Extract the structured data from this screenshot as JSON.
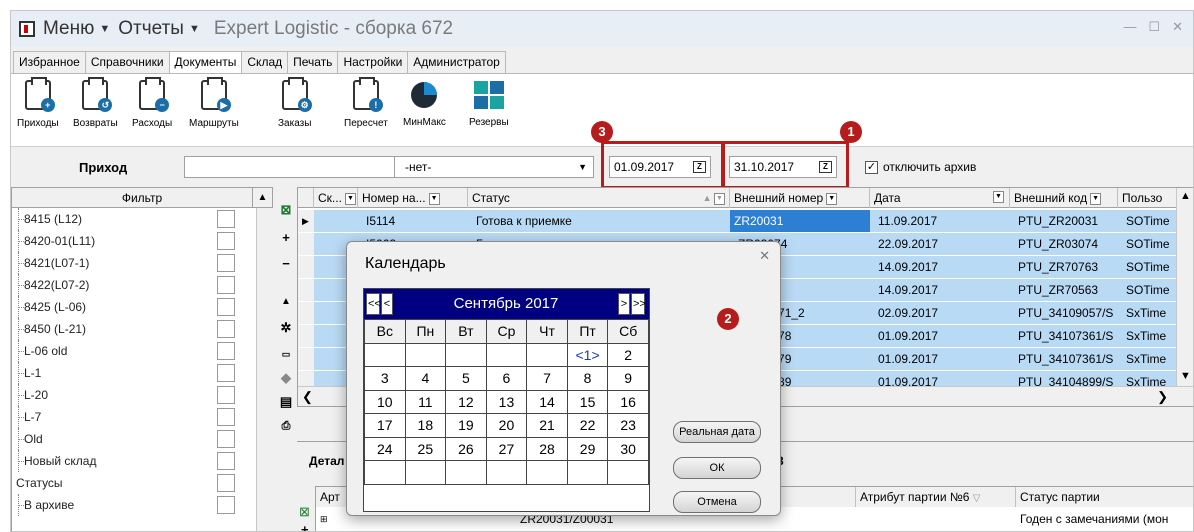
{
  "app": {
    "menu_label": "Меню",
    "reports_label": "Отчеты",
    "title": "Expert Logistic - сборка 672"
  },
  "tabs": [
    "Избранное",
    "Справочники",
    "Документы",
    "Склад",
    "Печать",
    "Настройки",
    "Администратор"
  ],
  "ribbon": {
    "buttons": [
      {
        "label": "Приходы",
        "icon": "incoming-icon"
      },
      {
        "label": "Возвраты",
        "icon": "returns-icon"
      },
      {
        "label": "Расходы",
        "icon": "outgoing-icon"
      },
      {
        "label": "Маршруты",
        "icon": "routes-icon"
      },
      {
        "label": "Заказы",
        "icon": "orders-icon"
      },
      {
        "label": "Пересчет",
        "icon": "recount-icon"
      },
      {
        "label": "МинМакс",
        "icon": "pie-chart-icon"
      },
      {
        "label": "Резервы",
        "icon": "grid-icon"
      }
    ]
  },
  "filterbar": {
    "doc_type": "Приход",
    "status_select": "-нет-",
    "date_from": "01.09.2017",
    "date_to": "31.10.2017",
    "archive_checkbox": "отключить архив",
    "archive_checked": true
  },
  "markers": [
    "1",
    "2",
    "3"
  ],
  "left_panel": {
    "header": "Фильтр",
    "items": [
      "8415 (L12)",
      "8420-01(L11)",
      "8421(L07-1)",
      "8422(L07-2)",
      "8425 (L-06)",
      "8450 (L-21)",
      "L-06 old",
      "L-1",
      "L-20",
      "L-7",
      "Old",
      "Новый склад"
    ],
    "section": "Статусы",
    "section_item": "В архиве"
  },
  "grid": {
    "columns": [
      "Ск...",
      "Номер на...",
      "Статус",
      "Внешний номер",
      "Дата",
      "Внешний код",
      "Пользо"
    ],
    "rows": [
      {
        "num": "I5114",
        "status": "Готова к приемке",
        "ext": "ZR20031",
        "date": "11.09.2017",
        "code": "PTU_ZR20031",
        "user": "SOTime"
      },
      {
        "num": "I5062",
        "status": "Готова к приемке",
        "ext": "ZR03074",
        "date": "22.09.2017",
        "code": "PTU_ZR03074",
        "user": "SOTime"
      },
      {
        "num": "",
        "status": "",
        "ext": "",
        "date": "14.09.2017",
        "code": "PTU_ZR70763",
        "user": "SOTime"
      },
      {
        "num": "",
        "status": "",
        "ext": "",
        "date": "14.09.2017",
        "code": "PTU_ZR70563",
        "user": "SOTime"
      },
      {
        "num": "",
        "status": "",
        "ext": "7/SH0471_2",
        "date": "02.09.2017",
        "code": "PTU_34109057/S",
        "user": "SxTime"
      },
      {
        "num": "",
        "status": "",
        "ext": "1/SH0578",
        "date": "01.09.2017",
        "code": "PTU_34107361/S",
        "user": "SxTime"
      },
      {
        "num": "",
        "status": "",
        "ext": "1/SH0579",
        "date": "01.09.2017",
        "code": "PTU_34107361/S",
        "user": "SxTime"
      },
      {
        "num": "",
        "status": "",
        "ext": "9/SH0589",
        "date": "01.09.2017",
        "code": "PTU_34104899/S",
        "user": "SxTime"
      }
    ]
  },
  "detail": {
    "tab": "Детал",
    "tab_suffix": "3",
    "col_art": "Арт",
    "col_attr": "Атрибут партии №6",
    "col_status": "Статус партии",
    "row_value": "ZR20031/Z00031",
    "row_status": "Годен с замечаниями (мон"
  },
  "calendar": {
    "title": "Календарь",
    "month": "Сентябрь 2017",
    "prev_year": "<<",
    "prev_month": "<",
    "next_month": ">",
    "next_year": ">>",
    "weekdays": [
      "Вс",
      "Пн",
      "Вт",
      "Ср",
      "Чт",
      "Пт",
      "Сб"
    ],
    "weeks": [
      [
        "",
        "",
        "",
        "",
        "",
        "<1>",
        "2"
      ],
      [
        "3",
        "4",
        "5",
        "6",
        "7",
        "8",
        "9"
      ],
      [
        "10",
        "11",
        "12",
        "13",
        "14",
        "15",
        "16"
      ],
      [
        "17",
        "18",
        "19",
        "20",
        "21",
        "22",
        "23"
      ],
      [
        "24",
        "25",
        "26",
        "27",
        "28",
        "29",
        "30"
      ],
      [
        "",
        "",
        "",
        "",
        "",
        "",
        ""
      ]
    ],
    "btn_real_date": "Реальная дата",
    "btn_ok": "ОК",
    "btn_cancel": "Отмена"
  }
}
